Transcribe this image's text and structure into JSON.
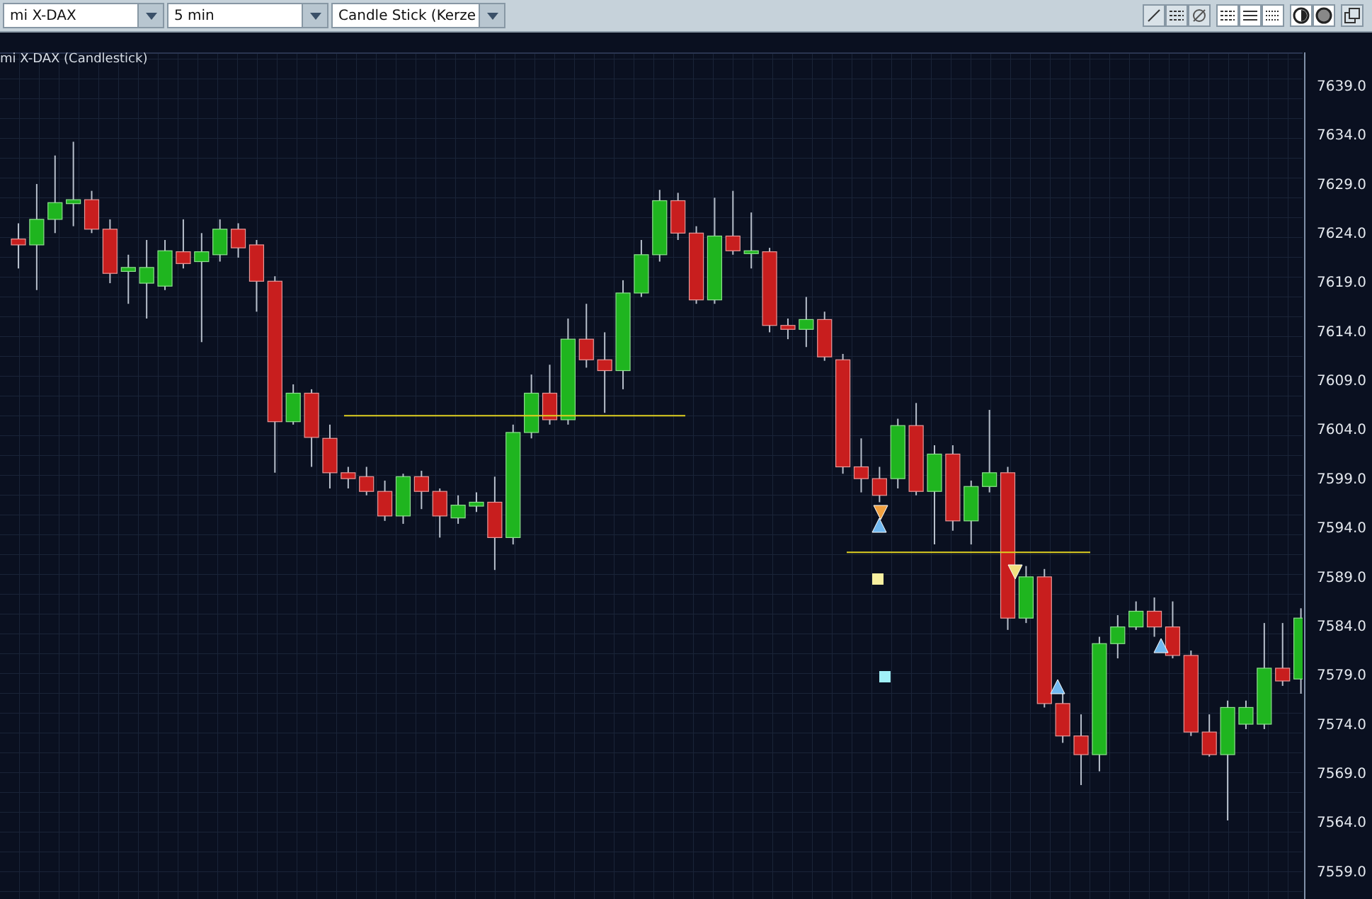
{
  "toolbar": {
    "dropdowns": [
      {
        "value": "mi X-DAX"
      },
      {
        "value": "5 min"
      },
      {
        "value": "Candle Stick (Kerze"
      }
    ]
  },
  "chart": {
    "title": "mi X-DAX (Candlestick)",
    "chart_data": {
      "type": "candlestick",
      "ylim": [
        7556.1,
        7642.3
      ],
      "ref_lines": [
        {
          "axis": "y",
          "value": 7605.3
        },
        {
          "axis": "y",
          "value": 7591.4
        }
      ],
      "ohlc": [
        [
          7623.3,
          7624.9,
          7620.3,
          7622.7
        ],
        [
          7622.7,
          7628.9,
          7618.1,
          7625.3
        ],
        [
          7625.3,
          7631.8,
          7623.9,
          7627.0
        ],
        [
          7626.9,
          7633.2,
          7624.6,
          7627.3
        ],
        [
          7627.3,
          7628.2,
          7623.9,
          7624.3
        ],
        [
          7624.3,
          7625.3,
          7618.8,
          7619.8
        ],
        [
          7620.0,
          7621.7,
          7616.7,
          7620.4
        ],
        [
          7618.8,
          7623.2,
          7615.2,
          7620.4
        ],
        [
          7618.5,
          7623.2,
          7618.1,
          7622.1
        ],
        [
          7622.0,
          7625.3,
          7620.3,
          7620.8
        ],
        [
          7621.0,
          7623.9,
          7612.8,
          7622.0
        ],
        [
          7621.7,
          7625.3,
          7621.0,
          7624.3
        ],
        [
          7624.3,
          7624.9,
          7621.4,
          7622.4
        ],
        [
          7622.7,
          7623.2,
          7615.9,
          7619.0
        ],
        [
          7619.0,
          7619.5,
          7599.5,
          7604.7
        ],
        [
          7604.7,
          7608.5,
          7604.4,
          7607.6
        ],
        [
          7607.6,
          7608.0,
          7600.1,
          7603.1
        ],
        [
          7603.0,
          7604.4,
          7597.9,
          7599.5
        ],
        [
          7599.5,
          7600.1,
          7597.9,
          7598.9
        ],
        [
          7599.1,
          7600.1,
          7597.2,
          7597.6
        ],
        [
          7597.6,
          7598.7,
          7594.6,
          7595.1
        ],
        [
          7595.1,
          7599.4,
          7594.3,
          7599.1
        ],
        [
          7599.1,
          7599.7,
          7595.8,
          7597.6
        ],
        [
          7597.6,
          7597.9,
          7592.9,
          7595.1
        ],
        [
          7594.9,
          7597.2,
          7594.3,
          7596.2
        ],
        [
          7596.1,
          7597.5,
          7595.5,
          7596.5
        ],
        [
          7596.5,
          7599.1,
          7589.6,
          7592.9
        ],
        [
          7592.9,
          7604.4,
          7592.2,
          7603.6
        ],
        [
          7603.6,
          7609.5,
          7603.0,
          7607.6
        ],
        [
          7607.6,
          7610.5,
          7604.4,
          7604.9
        ],
        [
          7604.9,
          7615.2,
          7604.4,
          7613.1
        ],
        [
          7613.1,
          7616.7,
          7610.2,
          7611.0
        ],
        [
          7611.0,
          7613.8,
          7605.6,
          7609.9
        ],
        [
          7609.9,
          7619.1,
          7608.0,
          7617.8
        ],
        [
          7617.8,
          7623.2,
          7617.4,
          7621.7
        ],
        [
          7621.7,
          7628.3,
          7621.0,
          7627.2
        ],
        [
          7627.2,
          7628.0,
          7623.2,
          7623.9
        ],
        [
          7623.9,
          7624.6,
          7616.7,
          7617.1
        ],
        [
          7617.1,
          7627.5,
          7616.7,
          7623.6
        ],
        [
          7623.6,
          7628.2,
          7621.7,
          7622.1
        ],
        [
          7621.9,
          7626.0,
          7620.3,
          7622.1
        ],
        [
          7622.0,
          7622.4,
          7613.8,
          7614.5
        ],
        [
          7614.5,
          7615.2,
          7613.1,
          7614.1
        ],
        [
          7614.1,
          7617.4,
          7612.3,
          7615.1
        ],
        [
          7615.1,
          7615.9,
          7610.9,
          7611.3
        ],
        [
          7611.0,
          7611.6,
          7599.4,
          7600.1
        ],
        [
          7600.1,
          7603.0,
          7597.5,
          7598.9
        ],
        [
          7598.9,
          7600.1,
          7596.5,
          7597.2
        ],
        [
          7598.9,
          7605.0,
          7597.9,
          7604.3
        ],
        [
          7604.3,
          7606.6,
          7597.2,
          7597.6
        ],
        [
          7597.6,
          7602.3,
          7592.2,
          7601.4
        ],
        [
          7601.4,
          7602.3,
          7593.6,
          7594.6
        ],
        [
          7594.6,
          7598.7,
          7592.2,
          7598.1
        ],
        [
          7598.1,
          7605.9,
          7597.5,
          7599.5
        ],
        [
          7599.5,
          7600.1,
          7583.5,
          7584.7
        ],
        [
          7584.7,
          7590.0,
          7584.2,
          7588.9
        ],
        [
          7588.9,
          7589.7,
          7575.6,
          7576.0
        ],
        [
          7576.0,
          7577.0,
          7572.0,
          7572.7
        ],
        [
          7572.7,
          7574.9,
          7567.7,
          7570.8
        ],
        [
          7570.8,
          7582.8,
          7569.1,
          7582.1
        ],
        [
          7582.1,
          7585.0,
          7580.6,
          7583.8
        ],
        [
          7583.8,
          7586.4,
          7583.5,
          7585.4
        ],
        [
          7585.4,
          7586.8,
          7582.8,
          7583.8
        ],
        [
          7583.8,
          7586.4,
          7580.6,
          7580.9
        ],
        [
          7580.9,
          7581.4,
          7572.7,
          7573.1
        ],
        [
          7573.1,
          7574.9,
          7570.6,
          7570.8
        ],
        [
          7570.8,
          7576.3,
          7564.1,
          7575.6
        ],
        [
          7573.9,
          7576.3,
          7573.4,
          7575.6
        ],
        [
          7573.9,
          7584.2,
          7573.4,
          7579.6
        ],
        [
          7579.6,
          7584.2,
          7577.8,
          7578.3
        ],
        [
          7578.5,
          7585.7,
          7577.0,
          7584.7
        ]
      ],
      "yticks": [
        {
          "value": 7639,
          "label": "7639.0"
        },
        {
          "value": 7634,
          "label": "7634.0"
        },
        {
          "value": 7629,
          "label": "7629.0"
        },
        {
          "value": 7624,
          "label": "7624.0"
        },
        {
          "value": 7619,
          "label": "7619.0"
        },
        {
          "value": 7614,
          "label": "7614.0"
        },
        {
          "value": 7609,
          "label": "7609.0"
        },
        {
          "value": 7604,
          "label": "7604.0"
        },
        {
          "value": 7599,
          "label": "7599.0"
        },
        {
          "value": 7594,
          "label": "7594.0"
        },
        {
          "value": 7589,
          "label": "7589.0"
        },
        {
          "value": 7584,
          "label": "7584.0"
        },
        {
          "value": 7579,
          "label": "7579.0"
        },
        {
          "value": 7574,
          "label": "7574.0"
        },
        {
          "value": 7569,
          "label": "7569.0"
        },
        {
          "value": 7564,
          "label": "7564.0"
        },
        {
          "value": 7559,
          "label": "7559.0"
        }
      ]
    }
  }
}
